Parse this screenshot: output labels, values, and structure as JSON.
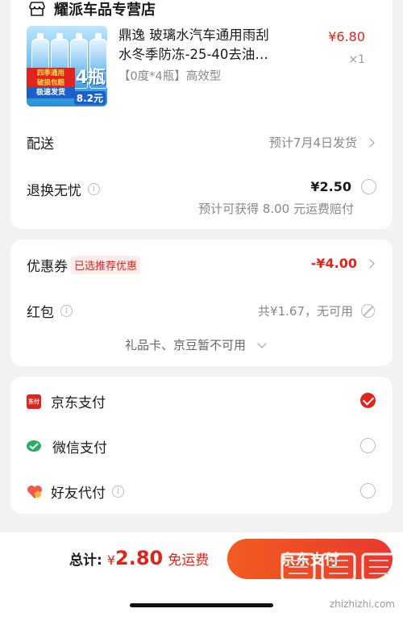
{
  "store": {
    "name": "耀派车品专营店"
  },
  "product": {
    "title_line1": "鼎逸 玻璃水汽车通用雨刮",
    "title_line2": "水冬季防冻-25-40去油…",
    "spec": "【0度*4瓶】高效型",
    "price": "¥6.80",
    "qty": "×1",
    "thumb": {
      "tag_season": "四季通用",
      "tag_damage": "破损包赔",
      "tag_fast": "极速发货",
      "tag_count": "4瓶",
      "tag_unit_price": "8.2元"
    }
  },
  "delivery": {
    "label": "配送",
    "value": "预计7月4日发货"
  },
  "return": {
    "label": "退换无忧",
    "price": "¥2.50",
    "note": "预计可获得 8.00 元运费赔付"
  },
  "coupon": {
    "label": "优惠券",
    "badge": "已选推荐优惠",
    "amount": "-¥4.00"
  },
  "redpacket": {
    "label": "红包",
    "value": "共¥1.67，无可用"
  },
  "giftcard": {
    "label": "礼品卡、京豆暂不可用"
  },
  "payments": [
    {
      "label": "京东支付",
      "icon": "jd-pay-icon"
    },
    {
      "label": "微信支付",
      "icon": "wechat-pay-icon"
    },
    {
      "label": "好友代付",
      "icon": "friend-pay-icon"
    }
  ],
  "jd_icon_text": "东付",
  "bottom": {
    "total_label": "总计:",
    "currency": "¥",
    "amount": "2.80",
    "shipping": "免运费",
    "pay_button": "京东支付"
  },
  "watermark": {
    "brand": "值值值",
    "url": "zhizhizhi.com"
  },
  "colors": {
    "accent": "#e2231a",
    "pay_gradient_start": "#f25c1f",
    "wechat": "#2aae67"
  }
}
